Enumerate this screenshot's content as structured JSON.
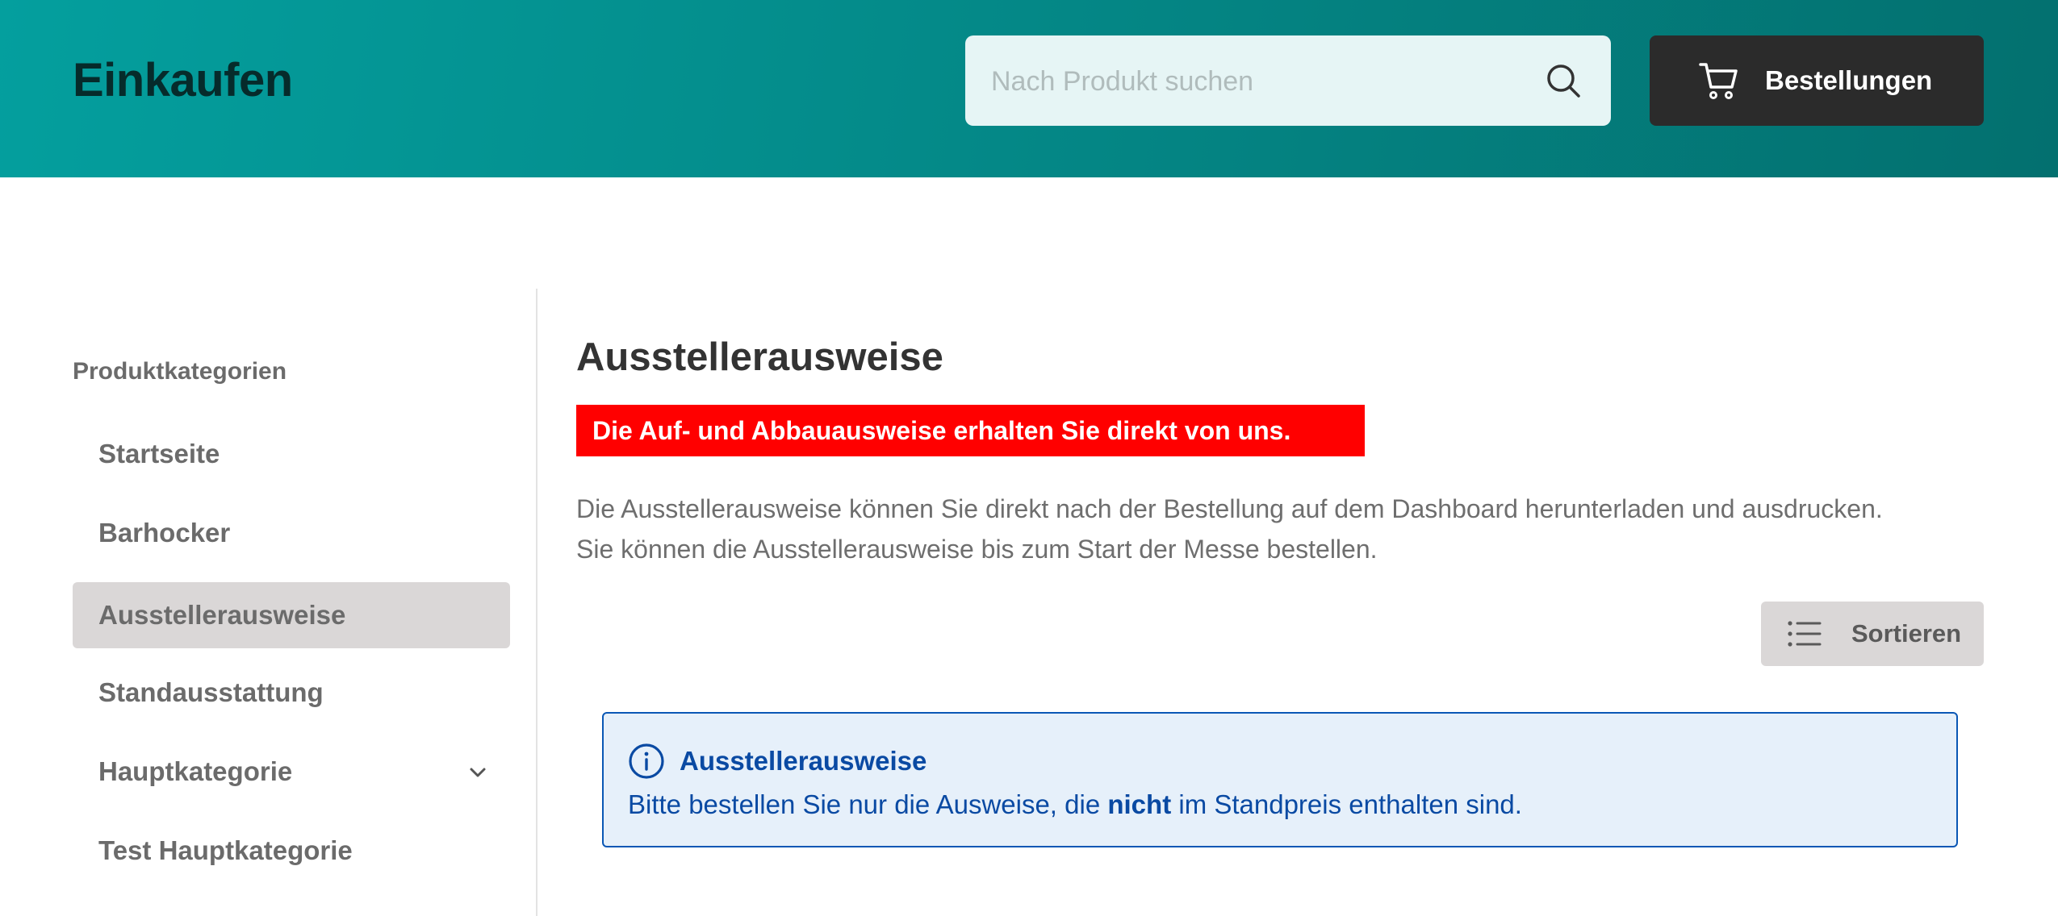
{
  "header": {
    "title": "Einkaufen",
    "search_placeholder": "Nach Produkt suchen",
    "orders_label": "Bestellungen"
  },
  "sidebar": {
    "heading": "Produktkategorien",
    "items": [
      {
        "label": "Startseite",
        "active": false
      },
      {
        "label": "Barhocker",
        "active": false
      },
      {
        "label": "Ausstellerausweise",
        "active": true
      },
      {
        "label": "Standausstattung",
        "active": false
      },
      {
        "label": "Hauptkategorie",
        "active": false,
        "expandable": true
      },
      {
        "label": "Test Hauptkategorie",
        "active": false
      }
    ]
  },
  "main": {
    "title": "Ausstellerausweise",
    "alert": "Die Auf- und Abbauausweise erhalten Sie direkt von uns.",
    "description": [
      "Die Ausstellerausweise können Sie direkt nach der Bestellung auf dem Dashboard herunterladen und ausdrucken.",
      "Sie können die Ausstellerausweise bis zum Start der Messe bestellen."
    ],
    "sort_label": "Sortieren",
    "info": {
      "title": "Ausstellerausweise",
      "text_before": "Bitte bestellen Sie nur die Ausweise, die ",
      "text_bold": "nicht",
      "text_after": " im Standpreis enthalten sind."
    }
  },
  "colors": {
    "header_start": "#049f9e",
    "header_end": "#03706f",
    "alert_bg": "#ff0000",
    "info_blue": "#0a4aa3",
    "info_bg": "#e6f0fa",
    "button_dark": "#2b2b2b"
  },
  "icons": [
    "search-icon",
    "cart-icon",
    "chevron-down-icon",
    "list-icon",
    "info-icon"
  ]
}
